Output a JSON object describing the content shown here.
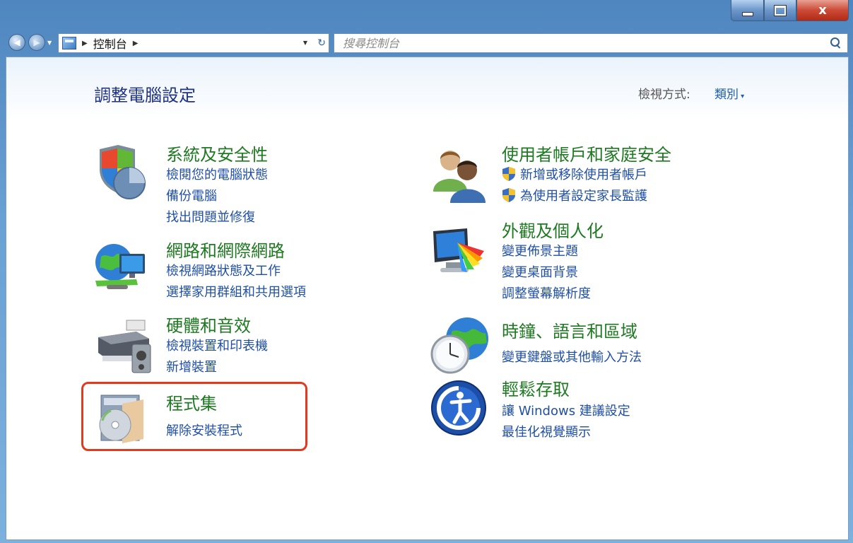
{
  "window": {
    "minimize_icon": "minimize-icon",
    "maximize_icon": "maximize-icon",
    "close_label": "x"
  },
  "address_bar": {
    "breadcrumb": [
      "控制台"
    ],
    "search_placeholder": "搜尋控制台"
  },
  "header": {
    "title": "調整電腦設定",
    "view_by_label": "檢視方式:",
    "view_by_value": "類別"
  },
  "left_categories": [
    {
      "icon": "system-security-icon",
      "title": "系統及安全性",
      "links": [
        "檢閱您的電腦狀態",
        "備份電腦",
        "找出問題並修復"
      ]
    },
    {
      "icon": "network-icon",
      "title": "網路和網際網路",
      "links": [
        "檢視網路狀態及工作",
        "選擇家用群組和共用選項"
      ]
    },
    {
      "icon": "hardware-sound-icon",
      "title": "硬體和音效",
      "links": [
        "檢視裝置和印表機",
        "新增裝置"
      ]
    },
    {
      "icon": "programs-icon",
      "title": "程式集",
      "links": [
        "解除安裝程式"
      ]
    }
  ],
  "right_categories": [
    {
      "icon": "user-accounts-icon",
      "title": "使用者帳戶和家庭安全",
      "links": [
        "新增或移除使用者帳戶",
        "為使用者設定家長監護"
      ]
    },
    {
      "icon": "appearance-icon",
      "title": "外觀及個人化",
      "links": [
        "變更佈景主題",
        "變更桌面背景",
        "調整螢幕解析度"
      ]
    },
    {
      "icon": "clock-language-region-icon",
      "title": "時鐘、語言和區域",
      "links": [
        "變更鍵盤或其他輸入方法"
      ]
    },
    {
      "icon": "ease-of-access-icon",
      "title": "輕鬆存取",
      "links": [
        "讓 Windows 建議設定",
        "最佳化視覺顯示"
      ]
    }
  ],
  "colors": {
    "title_green": "#1e7a20",
    "link_blue": "#1f4fa6",
    "highlight_red": "#e03a1f"
  }
}
